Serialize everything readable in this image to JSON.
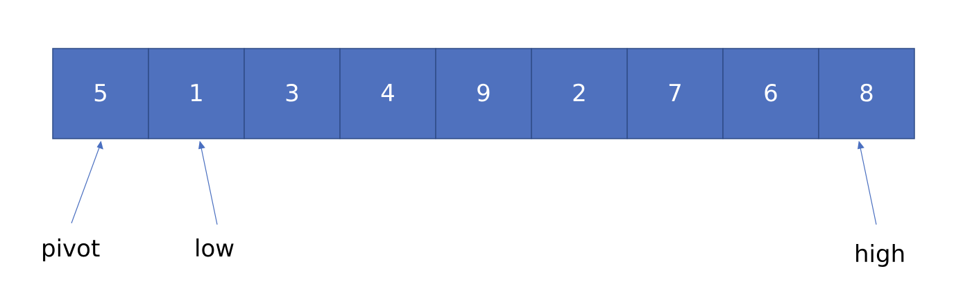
{
  "array": {
    "values": [
      "5",
      "1",
      "3",
      "4",
      "9",
      "2",
      "7",
      "6",
      "8"
    ]
  },
  "pointers": {
    "pivot": "pivot",
    "low": "low",
    "high": "high"
  },
  "colors": {
    "cell_fill": "#4f71be",
    "cell_border": "#2f4b86",
    "cell_text": "#ffffff",
    "arrow": "#4a6fc0",
    "label_text": "#000000"
  }
}
